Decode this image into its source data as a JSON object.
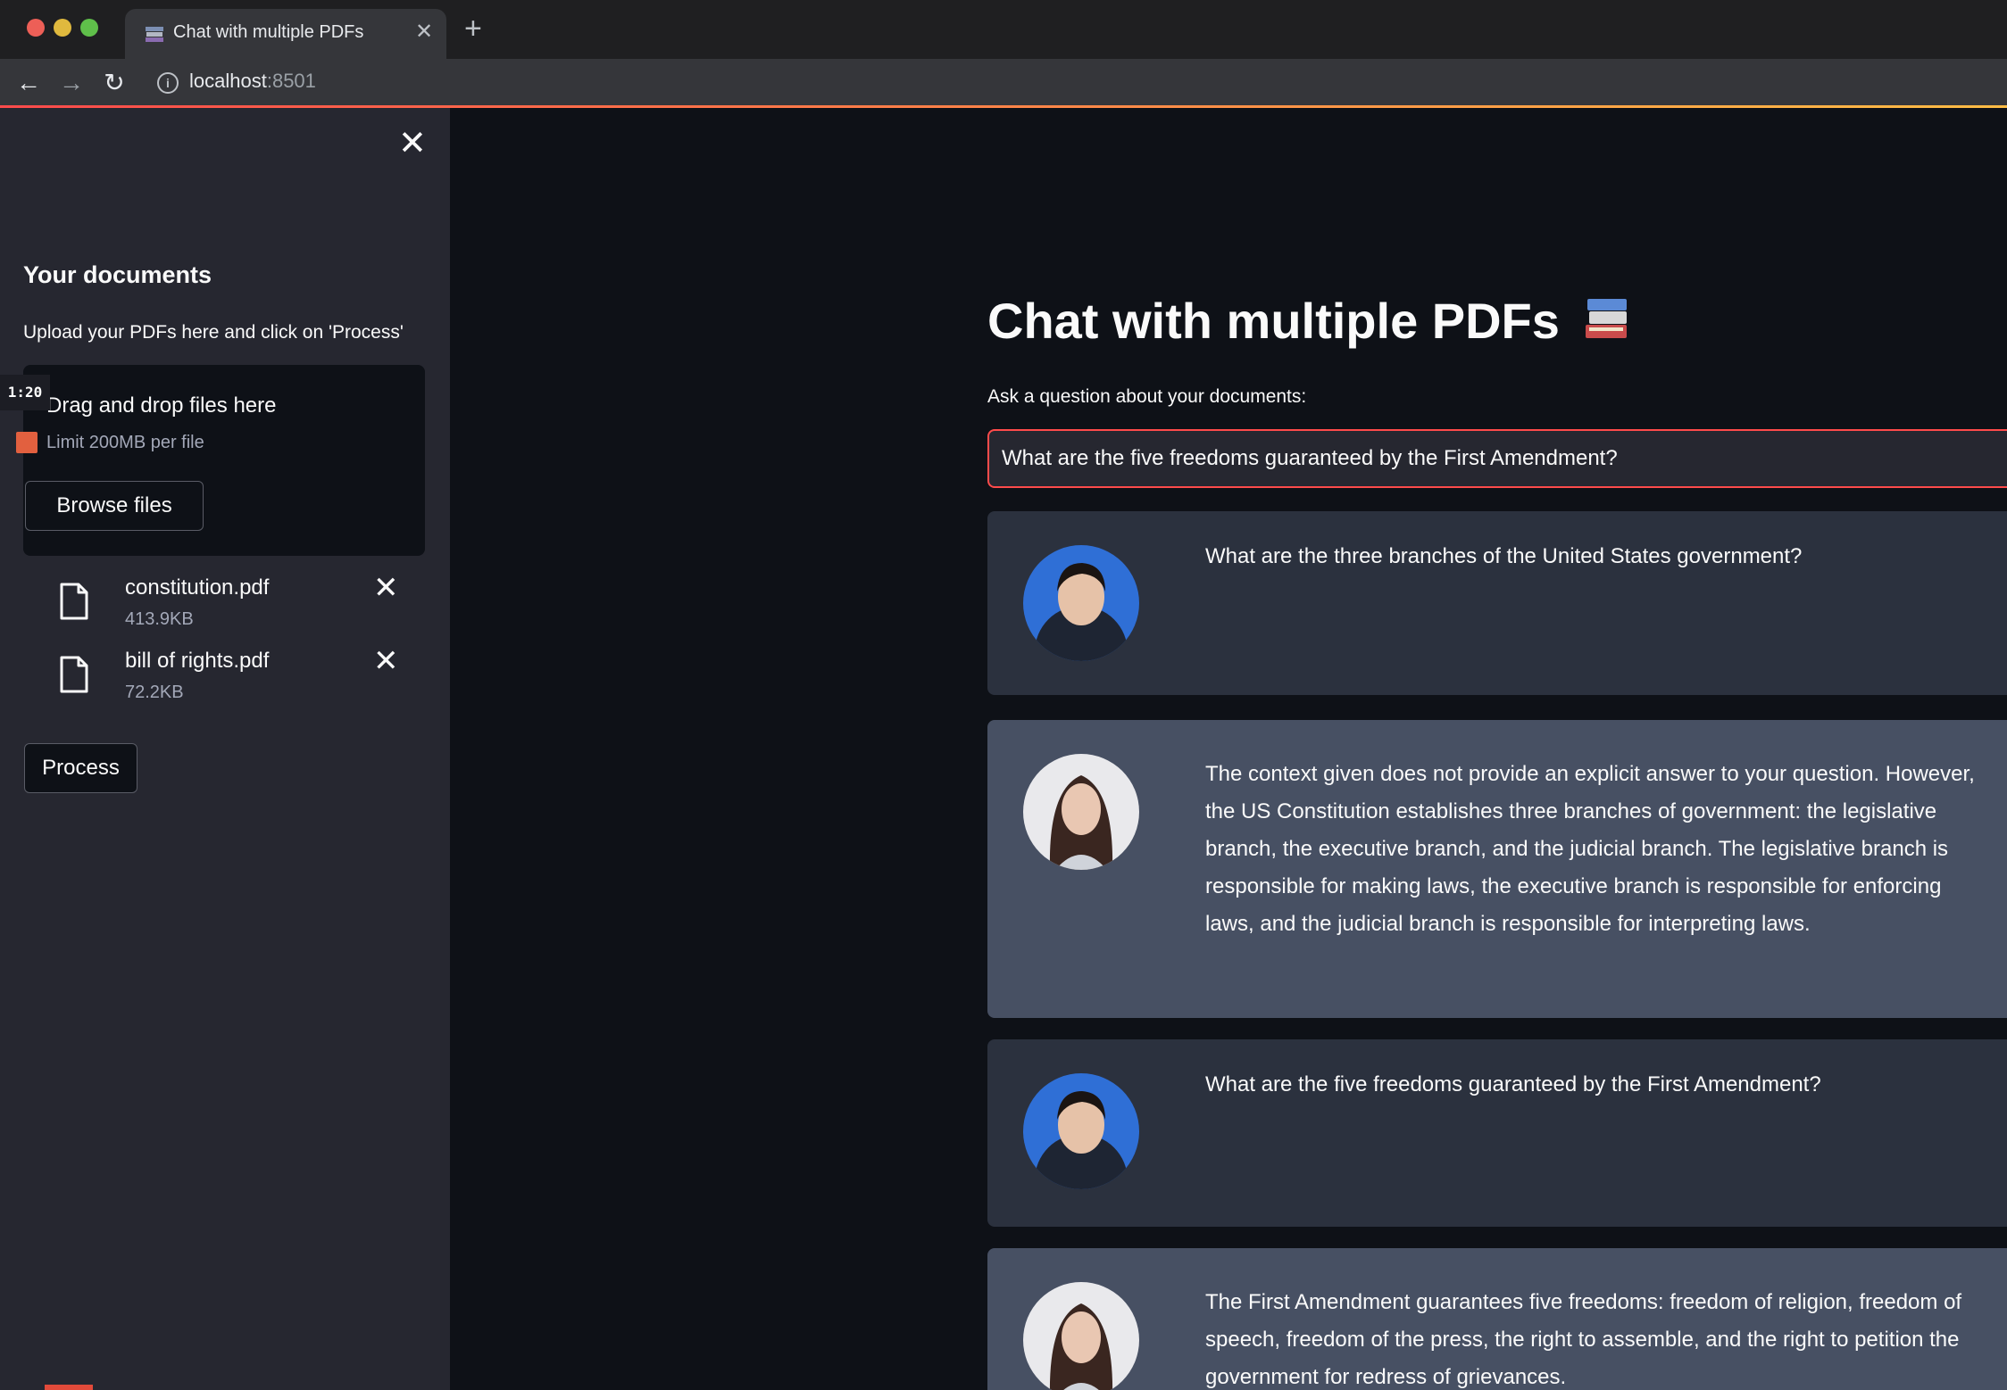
{
  "browser": {
    "tab_title": "Chat with multiple PDFs",
    "url_host": "localhost",
    "url_port": ":8501"
  },
  "sidebar": {
    "title": "Your documents",
    "subtitle": "Upload your PDFs here and click on 'Process'",
    "dropzone_title": "Drag and drop files here",
    "dropzone_limit": "Limit 200MB per file",
    "browse_label": "Browse files",
    "files": [
      {
        "name": "constitution.pdf",
        "size": "413.9KB"
      },
      {
        "name": "bill of rights.pdf",
        "size": "72.2KB"
      }
    ],
    "process_label": "Process"
  },
  "recorder": {
    "time": "1:20"
  },
  "main": {
    "title": "Chat with multiple PDFs",
    "question_label": "Ask a question about your documents:",
    "question_value": "What are the five freedoms guaranteed by the First Amendment?",
    "messages": [
      {
        "role": "user",
        "text": "What are the three branches of the United States government?"
      },
      {
        "role": "bot",
        "text": "The context given does not provide an explicit answer to your question. However, the US Constitution establishes three branches of government: the legislative branch, the executive branch, and the judicial branch. The legislative branch is responsible for making laws, the executive branch is responsible for enforcing laws, and the judicial branch is responsible for interpreting laws."
      },
      {
        "role": "user",
        "text": "What are the five freedoms guaranteed by the First Amendment?"
      },
      {
        "role": "bot",
        "text": "The First Amendment guarantees five freedoms: freedom of religion, freedom of speech, freedom of the press, the right to assemble, and the right to petition the government for redress of grievances."
      }
    ]
  },
  "colors": {
    "accent": "#ff4b4b",
    "sidebar_bg": "#262730",
    "main_bg": "#0e1117",
    "user_msg_bg": "#2b313e",
    "bot_msg_bg": "#475063"
  },
  "icons": {
    "favicon": "books-icon",
    "title_emoji": "books-emoji-icon",
    "file": "file-icon",
    "remove": "close-icon"
  }
}
